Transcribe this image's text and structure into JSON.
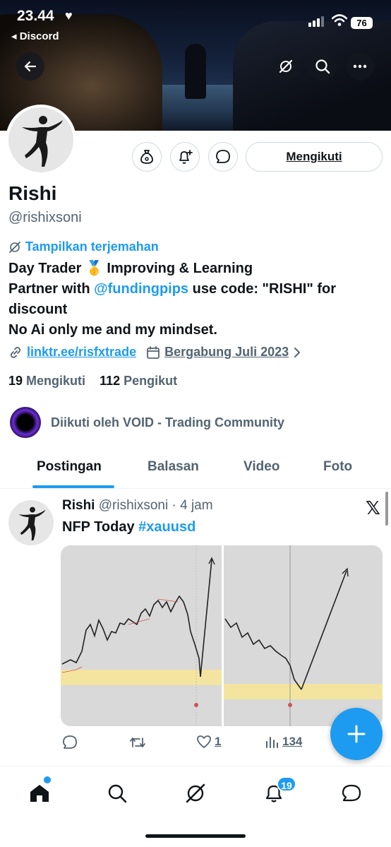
{
  "status_bar": {
    "time": "23.44",
    "back_app": "◂ Discord",
    "battery": "76"
  },
  "profile": {
    "name": "Rishi",
    "handle": "@rishixsoni",
    "translate": "Tampilkan terjemahan",
    "bio_line1": "Day Trader 🥇 Improving & Learning",
    "bio_line2_pre": "Partner with ",
    "bio_mention": "@fundingpips",
    "bio_line2_post": " use code: \"RISHI\" for",
    "bio_line3": "discount",
    "bio_line4": "No Ai only me and my mindset.",
    "link": "linktr.ee/risfxtrade",
    "joined": "Bergabung Juli 2023",
    "following_count": "19",
    "following_label": "Mengikuti",
    "followers_count": "112",
    "followers_label": "Pengikut",
    "followed_by": "Diikuti oleh VOID - Trading Community",
    "follow_button": "Mengikuti"
  },
  "tabs": [
    "Postingan",
    "Balasan",
    "Video",
    "Foto"
  ],
  "tweet": {
    "name": "Rishi",
    "handle": "@rishixsoni",
    "time": "· 4 jam",
    "text_pre": "NFP Today ",
    "hashtag": "#xauusd",
    "likes": "1",
    "views": "134"
  },
  "nav": {
    "notifications_badge": "19"
  },
  "colors": {
    "accent": "#1d9bf0",
    "text": "#0f1419",
    "muted": "#536471"
  }
}
